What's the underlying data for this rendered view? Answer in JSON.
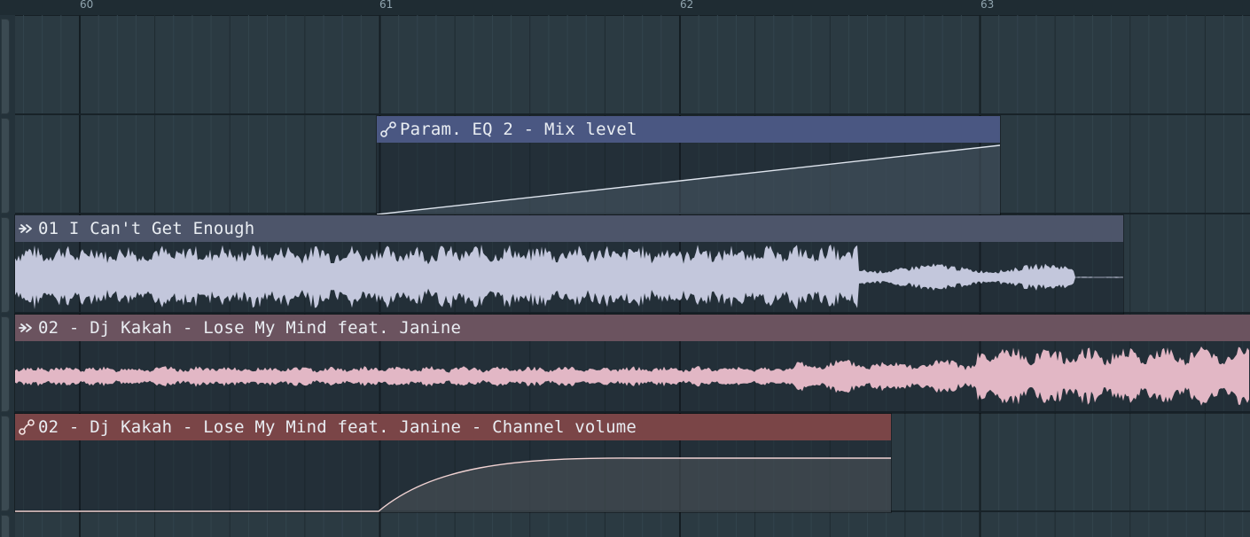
{
  "ruler": {
    "bars": [
      "60",
      "61",
      "62",
      "63"
    ]
  },
  "clips": [
    {
      "id": "eq",
      "title": "Param. EQ 2 - Mix level",
      "icon": "automation-curve-icon",
      "header_color": "#4a5782",
      "wave_color": "#c3c8e0"
    },
    {
      "id": "track1",
      "title": "01 I Can't Get Enough",
      "icon": "audio-clip-icon",
      "header_color": "#4d556a",
      "wave_color": "#c3c7dc"
    },
    {
      "id": "track2",
      "title": "02 - Dj Kakah - Lose My Mind feat. Janine",
      "icon": "audio-clip-icon",
      "header_color": "#6b535f",
      "wave_color": "#e2b7c5"
    },
    {
      "id": "vol",
      "title": "02 - Dj Kakah - Lose My Mind feat. Janine - Channel volume",
      "icon": "automation-curve-icon",
      "header_color": "#7a4547",
      "wave_color": "#f0c8c8"
    }
  ]
}
